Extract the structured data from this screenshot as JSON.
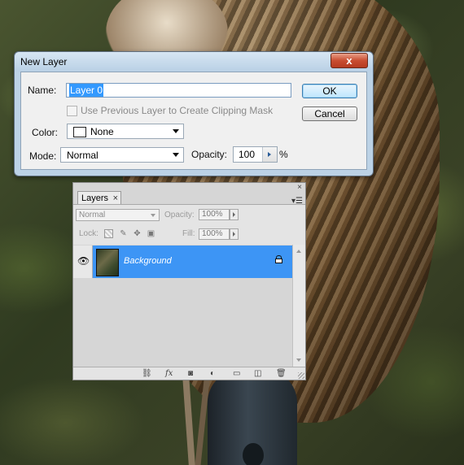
{
  "dialog": {
    "title": "New Layer",
    "close_label": "x",
    "name_label": "Name:",
    "name_value": "Layer 0",
    "clipping_label": "Use Previous Layer to Create Clipping Mask",
    "color_label": "Color:",
    "color_value": "None",
    "mode_label": "Mode:",
    "mode_value": "Normal",
    "opacity_label": "Opacity:",
    "opacity_value": "100",
    "opacity_unit": "%",
    "ok_label": "OK",
    "cancel_label": "Cancel"
  },
  "layers_panel": {
    "tab_label": "Layers",
    "tab_close": "×",
    "panel_close": "×",
    "menu_glyph": "▾☰",
    "blend_mode": "Normal",
    "opacity_label": "Opacity:",
    "opacity_value": "100%",
    "lock_label": "Lock:",
    "fill_label": "Fill:",
    "fill_value": "100%",
    "layers": [
      {
        "name": "Background",
        "visible": true,
        "locked": true,
        "selected": true
      }
    ],
    "bottom_icons": [
      "link-icon",
      "fx-icon",
      "mask-icon",
      "adjustment-icon",
      "group-folder-icon",
      "new-layer-icon",
      "trash-icon"
    ],
    "fx_label": "fx"
  },
  "colors": {
    "selection_blue": "#3d95f5",
    "dialog_frame": "#bcd2e6",
    "close_red": "#c94d31"
  }
}
